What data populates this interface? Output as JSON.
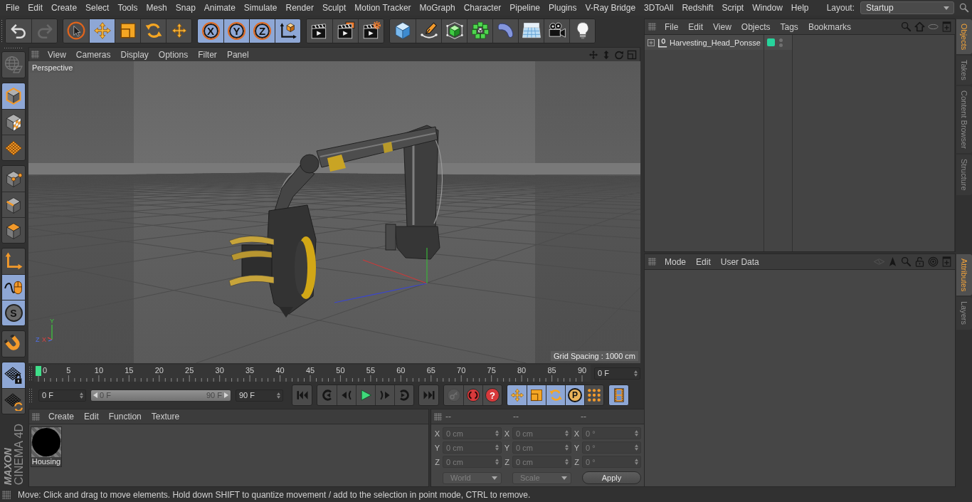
{
  "menu_bar": {
    "items": [
      "File",
      "Edit",
      "Create",
      "Select",
      "Tools",
      "Mesh",
      "Snap",
      "Animate",
      "Simulate",
      "Render",
      "Sculpt",
      "Motion Tracker",
      "MoGraph",
      "Character",
      "Pipeline",
      "Plugins",
      "V-Ray Bridge",
      "3DToAll",
      "Redshift",
      "Script",
      "Window",
      "Help"
    ],
    "layout_label": "Layout:",
    "layout_value": "Startup"
  },
  "toolbar": {
    "groups": [
      [
        {
          "kind": "undo",
          "selected": false,
          "disabled": false
        },
        {
          "kind": "redo",
          "selected": false,
          "disabled": true
        }
      ],
      [
        {
          "kind": "select",
          "selected": false,
          "disabled": false
        },
        {
          "kind": "move",
          "selected": true,
          "disabled": false
        },
        {
          "kind": "scale",
          "selected": false,
          "disabled": false
        },
        {
          "kind": "rotate",
          "selected": false,
          "disabled": false
        },
        {
          "kind": "transform",
          "selected": false,
          "disabled": false
        }
      ],
      [
        {
          "kind": "axis_lock",
          "label": "X",
          "selected": true,
          "disabled": false
        },
        {
          "kind": "axis_lock",
          "label": "Y",
          "selected": true,
          "disabled": false
        },
        {
          "kind": "axis_lock",
          "label": "Z",
          "selected": true,
          "disabled": false
        },
        {
          "kind": "coord_system",
          "selected": true,
          "disabled": false
        }
      ],
      [
        {
          "kind": "render_view",
          "selected": false,
          "disabled": false
        },
        {
          "kind": "render_viewer",
          "selected": false,
          "disabled": false
        },
        {
          "kind": "render_settings",
          "selected": false,
          "disabled": false
        }
      ],
      [
        {
          "kind": "cube",
          "selected": false,
          "disabled": false
        },
        {
          "kind": "pen",
          "selected": false,
          "disabled": false
        },
        {
          "kind": "subdivision",
          "selected": false,
          "disabled": false
        },
        {
          "kind": "cloner",
          "selected": false,
          "disabled": false
        },
        {
          "kind": "deformer",
          "selected": false,
          "disabled": false
        },
        {
          "kind": "floor",
          "selected": false,
          "disabled": false
        },
        {
          "kind": "camera",
          "selected": false,
          "disabled": false
        },
        {
          "kind": "light",
          "selected": false,
          "disabled": false
        }
      ]
    ]
  },
  "left_toolbar": {
    "groups": [
      [
        {
          "kind": "globe",
          "selected": false,
          "disabled": true
        }
      ],
      [
        {
          "kind": "model",
          "selected": true,
          "disabled": false
        },
        {
          "kind": "texture",
          "selected": false,
          "disabled": false
        },
        {
          "kind": "workplane",
          "selected": false,
          "disabled": false
        }
      ],
      [
        {
          "kind": "points",
          "selected": false,
          "disabled": false
        },
        {
          "kind": "edges",
          "selected": false,
          "disabled": false
        },
        {
          "kind": "polygons",
          "selected": false,
          "disabled": false
        }
      ],
      [
        {
          "kind": "axis",
          "selected": false,
          "disabled": false
        },
        {
          "kind": "tweak",
          "selected": true,
          "disabled": false
        },
        {
          "kind": "solo",
          "label": "S",
          "selected": true,
          "disabled": false
        }
      ],
      [
        {
          "kind": "snap",
          "selected": false,
          "disabled": false
        }
      ],
      [
        {
          "kind": "workplane_lock",
          "selected": true,
          "disabled": false
        },
        {
          "kind": "workplane_align",
          "selected": false,
          "disabled": false
        }
      ]
    ]
  },
  "logo": {
    "brand": "MAXON",
    "product": "CINEMA 4D"
  },
  "viewport": {
    "menu": [
      "View",
      "Cameras",
      "Display",
      "Options",
      "Filter",
      "Panel"
    ],
    "camera": "Perspective",
    "grid_spacing": "Grid Spacing : 1000 cm",
    "axis_gizmo": [
      {
        "kind": "y",
        "label": "Y"
      },
      {
        "kind": "z",
        "label": "Z"
      },
      {
        "kind": "x",
        "label": "X"
      }
    ]
  },
  "timeline": {
    "ticks": [
      "0",
      "5",
      "10",
      "15",
      "20",
      "25",
      "30",
      "35",
      "40",
      "45",
      "50",
      "55",
      "60",
      "65",
      "70",
      "75",
      "80",
      "85",
      "90"
    ],
    "level": 0,
    "current_frame": "0 F"
  },
  "transport": {
    "start": "0 F",
    "range": {
      "start": "0 F",
      "end": "90 F",
      "level": 1
    },
    "end": "90 F",
    "groups": [
      [
        {
          "kind": "go_start",
          "selected": false,
          "disabled": false
        }
      ],
      [
        {
          "kind": "prev_key",
          "selected": false,
          "disabled": false
        },
        {
          "kind": "prev_frame",
          "selected": false,
          "disabled": false
        },
        {
          "kind": "play",
          "selected": false,
          "disabled": false
        },
        {
          "kind": "next_frame",
          "selected": false,
          "disabled": false
        },
        {
          "kind": "next_key",
          "selected": false,
          "disabled": false
        }
      ],
      [
        {
          "kind": "go_end",
          "selected": false,
          "disabled": false
        }
      ],
      [
        {
          "kind": "record_active",
          "selected": false,
          "disabled": true
        },
        {
          "kind": "autokey",
          "selected": false,
          "disabled": false
        },
        {
          "kind": "keyframe_selection",
          "label": "?",
          "selected": false,
          "disabled": false
        }
      ],
      [
        {
          "kind": "key_position",
          "selected": true,
          "disabled": false
        },
        {
          "kind": "key_scale",
          "selected": true,
          "disabled": false
        },
        {
          "kind": "key_rotation",
          "selected": true,
          "disabled": false
        },
        {
          "kind": "key_param",
          "label": "P",
          "selected": true,
          "disabled": false
        },
        {
          "kind": "key_pla",
          "selected": false,
          "disabled": false
        }
      ],
      [
        {
          "kind": "timeline_window",
          "selected": true,
          "disabled": false
        }
      ]
    ]
  },
  "material_manager": {
    "menu": [
      "Create",
      "Edit",
      "Function",
      "Texture"
    ],
    "materials": [
      {
        "name": "Housing"
      }
    ]
  },
  "coordinates": {
    "headers": [
      "--",
      "--",
      "--"
    ],
    "disabled": true,
    "rows": [
      {
        "cells": [
          {
            "label": "X",
            "value": "0 cm"
          },
          {
            "label": "X",
            "value": "0 cm"
          },
          {
            "label": "X",
            "value": "0 °"
          }
        ]
      },
      {
        "cells": [
          {
            "label": "Y",
            "value": "0 cm"
          },
          {
            "label": "Y",
            "value": "0 cm"
          },
          {
            "label": "Y",
            "value": "0 °"
          }
        ]
      },
      {
        "cells": [
          {
            "label": "Z",
            "value": "0 cm"
          },
          {
            "label": "Z",
            "value": "0 cm"
          },
          {
            "label": "Z",
            "value": "0 °"
          }
        ]
      }
    ],
    "dropdowns": [
      "World",
      "Scale"
    ],
    "apply": "Apply"
  },
  "status_bar": {
    "text": "Move: Click and drag to move elements. Hold down SHIFT to quantize movement / add to the selection in point mode, CTRL to remove."
  },
  "object_manager": {
    "menu": [
      "File",
      "Edit",
      "View",
      "Objects",
      "Tags",
      "Bookmarks"
    ],
    "objects": [
      {
        "name": "Harvesting_Head_Ponsse",
        "expanded": false,
        "color": "#27d49c"
      }
    ]
  },
  "side_tabs": {
    "upper": [
      {
        "label": "Objects",
        "selected": true
      },
      {
        "label": "Takes",
        "selected": false
      },
      {
        "label": "Content Browser",
        "selected": false
      },
      {
        "label": "Structure",
        "selected": false
      }
    ],
    "lower": [
      {
        "label": "Attributes",
        "selected": true
      },
      {
        "label": "Layers",
        "selected": false
      }
    ]
  },
  "attribute_manager": {
    "menu": [
      "Mode",
      "Edit",
      "User Data"
    ]
  }
}
